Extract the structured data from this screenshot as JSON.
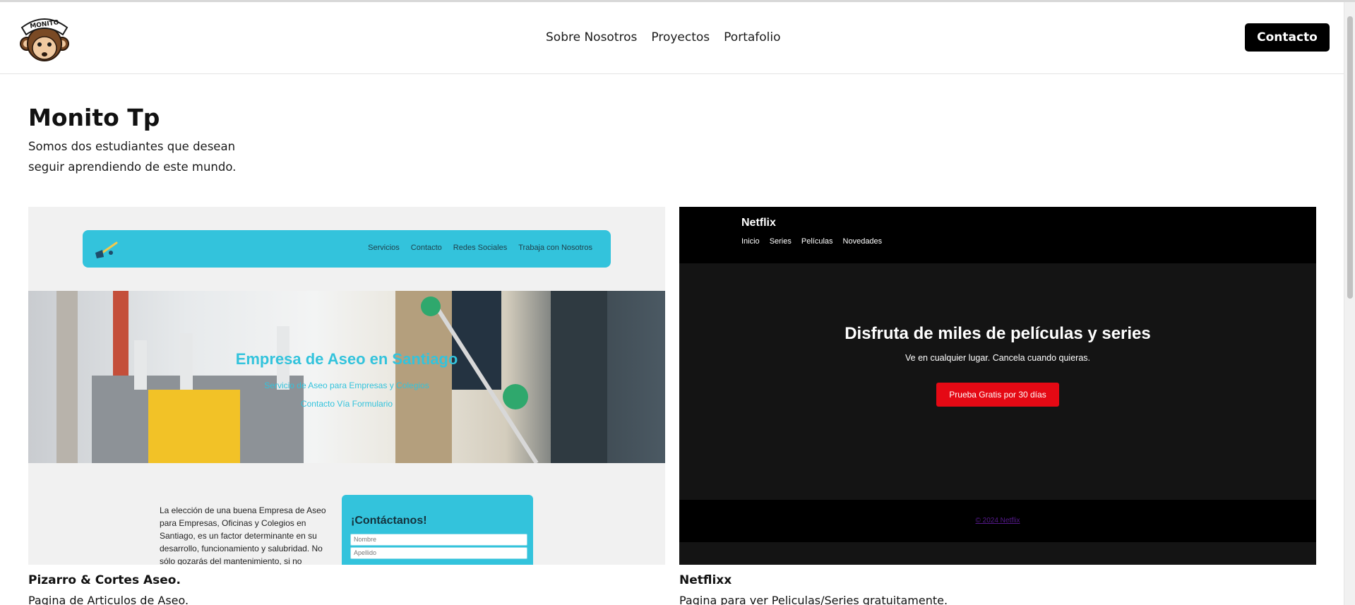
{
  "header": {
    "logo_text": "MONITO",
    "nav": [
      "Sobre Nosotros",
      "Proyectos",
      "Portafolio"
    ],
    "contact_label": "Contacto"
  },
  "hero": {
    "title": "Monito Tp",
    "description_line1": "Somos dos estudiantes que desean",
    "description_line2": "seguir aprendiendo de este mundo."
  },
  "projects": [
    {
      "title": "Pizarro & Cortes Aseo.",
      "description": "Pagina de Articulos de Aseo.",
      "preview": {
        "nav_links": [
          "Servicios",
          "Contacto",
          "Redes Sociales",
          "Trabaja con Nosotros"
        ],
        "hero_title": "Empresa de Aseo en Santiago",
        "hero_subtitle": "Servicio de Aseo para Empresas y Colegios",
        "hero_link": "Contacto Vía Formulario",
        "body_text": "La elección de una buena Empresa de Aseo para Empresas, Oficinas y Colegios en Santiago, es un factor determinante en su desarrollo, funcionamiento y salubridad. No sólo gozarás del mantenimiento, si no",
        "form_title": "¡Contáctanos!",
        "form_fields": [
          "Nombre",
          "Apellido"
        ],
        "accent": "#33c3dc"
      }
    },
    {
      "title": "Netflixx",
      "description": "Pagina para ver Peliculas/Series gratuitamente.",
      "preview": {
        "brand": "Netflix",
        "nav_links": [
          "Inicio",
          "Series",
          "Películas",
          "Novedades"
        ],
        "hero_title": "Disfruta de miles de películas y series",
        "hero_subtitle": "Ve en cualquier lugar. Cancela cuando quieras.",
        "cta": "Prueba Gratis por 30 días",
        "footer": "© 2024 Netflix",
        "accent": "#e50914"
      }
    }
  ]
}
